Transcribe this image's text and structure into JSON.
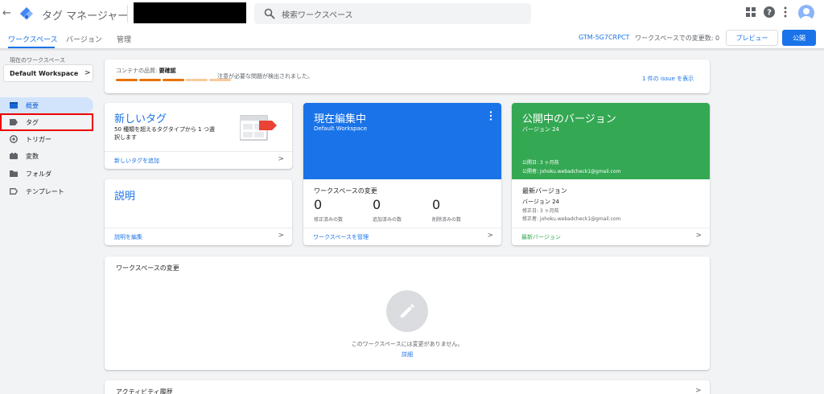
{
  "header": {
    "back_glyph": "←",
    "app_title": "タグ マネージャー",
    "search_placeholder": "検索ワークスペース"
  },
  "nav": {
    "tabs": [
      {
        "label": "ワークスペース",
        "active": true
      },
      {
        "label": "バージョン",
        "active": false
      },
      {
        "label": "管理",
        "active": false
      }
    ],
    "container_id": "GTM-5G7CRPCT",
    "changes_count": "ワークスペースでの変更数: 0",
    "preview_label": "プレビュー",
    "publish_label": "公開"
  },
  "sidebar": {
    "workspace_label": "現在のワークスペース",
    "workspace_name": "Default Workspace",
    "items": [
      {
        "label": "概要",
        "icon": "overview-icon",
        "active": true
      },
      {
        "label": "タグ",
        "icon": "tag-icon",
        "active": false
      },
      {
        "label": "トリガー",
        "icon": "trigger-icon",
        "active": false
      },
      {
        "label": "変数",
        "icon": "variables-icon",
        "active": false
      },
      {
        "label": "フォルダ",
        "icon": "folder-icon",
        "active": false
      },
      {
        "label": "テンプレート",
        "icon": "template-icon",
        "active": false
      }
    ]
  },
  "quality": {
    "label": "コンテナの品質:",
    "status": "要確認",
    "message": "注意が必要な問題が検出されました。",
    "link": "1 件の issue を表示",
    "colors": [
      "#e8710a",
      "#e8710a",
      "#e8710a",
      "#fbc99a",
      "#fbc99a"
    ]
  },
  "new_tag": {
    "title": "新しいタグ",
    "description": "50 種類を超えるタグタイプから 1 つ選択します",
    "link": "新しいタグを追加"
  },
  "description_card": {
    "title": "説明",
    "link": "説明を編集"
  },
  "editing": {
    "title": "現在編集中",
    "workspace": "Default Workspace",
    "changes_title": "ワークスペースの変更",
    "stats": [
      {
        "value": "0",
        "label": "修正済みの数"
      },
      {
        "value": "0",
        "label": "追加済みの数"
      },
      {
        "value": "0",
        "label": "削除済みの数"
      }
    ],
    "link": "ワークスペースを管理",
    "color": "#1a73e8"
  },
  "published": {
    "title": "公開中のバージョン",
    "version": "バージョン 24",
    "published_date": "公開日: 3 ヶ月前",
    "publisher": "公開者: johoku.webadcheck1@gmail.com",
    "latest_title": "最新バージョン",
    "latest_version": "バージョン 24",
    "modified_date": "修正日: 3 ヶ月前",
    "modifier": "修正者: johoku.webadcheck1@gmail.com",
    "link": "最新バージョン",
    "color": "#34a853"
  },
  "workspace_changes": {
    "title": "ワークスペースの変更",
    "empty_message": "このワークスペースには変更がありません。",
    "details_link": "詳細"
  },
  "activity": {
    "title": "アクティビティ履歴"
  }
}
